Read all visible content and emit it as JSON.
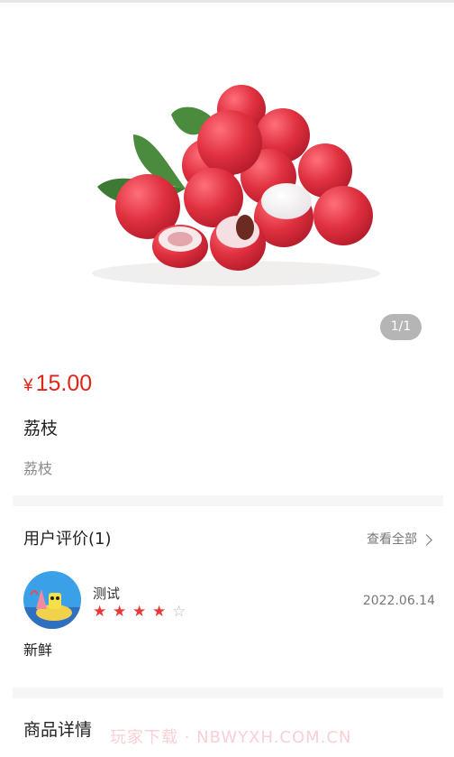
{
  "gallery": {
    "pager": "1/1"
  },
  "product": {
    "currency": "¥",
    "price": "15.00",
    "name": "荔枝",
    "description": "荔枝"
  },
  "reviews": {
    "title": "用户评价(1)",
    "view_all": "查看全部",
    "items": [
      {
        "user": "测试",
        "rating": 4,
        "rating_max": 5,
        "date": "2022.06.14",
        "comment": "新鲜"
      }
    ]
  },
  "details": {
    "title": "商品详情"
  },
  "watermark": "玩家下载 · NBWYXH.COM.CN",
  "colors": {
    "price": "#e0251b",
    "star_active": "#e53935",
    "star_inactive": "#b8b8b8"
  }
}
